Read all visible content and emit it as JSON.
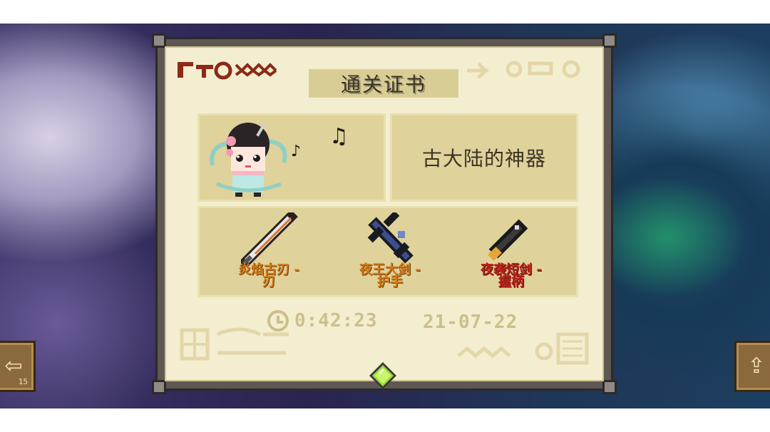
{
  "certificate": {
    "title": "通关证书",
    "character_name": "古大陆的神器",
    "time": "0:42:23",
    "date": "21-07-22"
  },
  "items": [
    {
      "label_line1": "炎焰古刃 -",
      "label_line2": "刃",
      "color": "#d07a1a",
      "icon": "orange-blade-icon"
    },
    {
      "label_line1": "夜王大剑 -",
      "label_line2": "护手",
      "color": "#d07a1a",
      "icon": "dark-guard-icon"
    },
    {
      "label_line1": "夜袭短剑 -",
      "label_line2": "握柄",
      "color": "#b8231b",
      "icon": "dagger-hilt-icon"
    }
  ],
  "buttons": {
    "exit_icon": "exit-icon",
    "exit_number": "15",
    "share_icon": "share-icon"
  },
  "colors": {
    "paper": "#f4eed0",
    "box": "#dfd29b",
    "frame": "#5d5853",
    "gem": "#9ee03a"
  }
}
